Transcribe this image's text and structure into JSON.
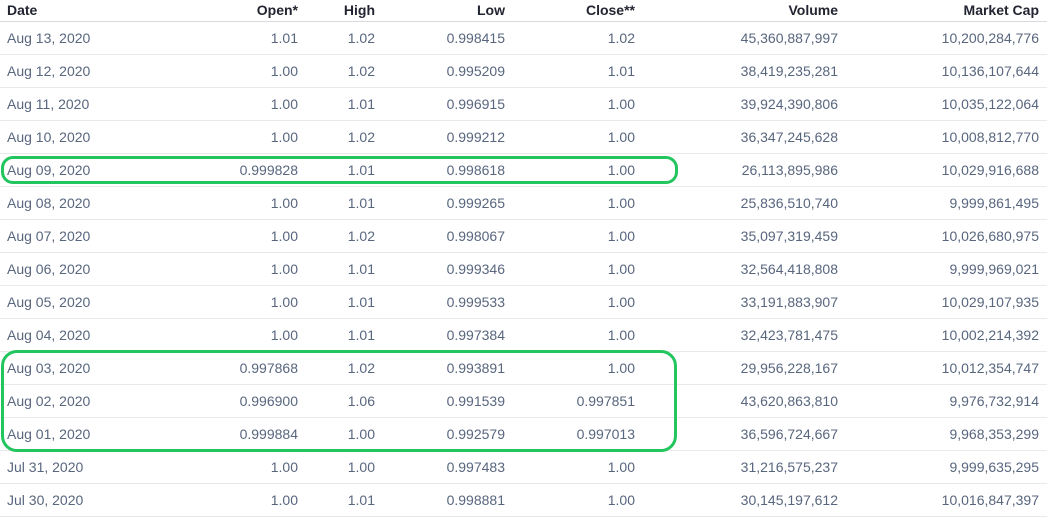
{
  "columns": {
    "date": "Date",
    "open": "Open*",
    "high": "High",
    "low": "Low",
    "close": "Close**",
    "volume": "Volume",
    "market_cap": "Market Cap"
  },
  "rows": [
    {
      "date": "Aug 13, 2020",
      "open": "1.01",
      "high": "1.02",
      "low": "0.998415",
      "close": "1.02",
      "volume": "45,360,887,997",
      "market_cap": "10,200,284,776"
    },
    {
      "date": "Aug 12, 2020",
      "open": "1.00",
      "high": "1.02",
      "low": "0.995209",
      "close": "1.01",
      "volume": "38,419,235,281",
      "market_cap": "10,136,107,644"
    },
    {
      "date": "Aug 11, 2020",
      "open": "1.00",
      "high": "1.01",
      "low": "0.996915",
      "close": "1.00",
      "volume": "39,924,390,806",
      "market_cap": "10,035,122,064"
    },
    {
      "date": "Aug 10, 2020",
      "open": "1.00",
      "high": "1.02",
      "low": "0.999212",
      "close": "1.00",
      "volume": "36,347,245,628",
      "market_cap": "10,008,812,770"
    },
    {
      "date": "Aug 09, 2020",
      "open": "0.999828",
      "high": "1.01",
      "low": "0.998618",
      "close": "1.00",
      "volume": "26,113,895,986",
      "market_cap": "10,029,916,688"
    },
    {
      "date": "Aug 08, 2020",
      "open": "1.00",
      "high": "1.01",
      "low": "0.999265",
      "close": "1.00",
      "volume": "25,836,510,740",
      "market_cap": "9,999,861,495"
    },
    {
      "date": "Aug 07, 2020",
      "open": "1.00",
      "high": "1.02",
      "low": "0.998067",
      "close": "1.00",
      "volume": "35,097,319,459",
      "market_cap": "10,026,680,975"
    },
    {
      "date": "Aug 06, 2020",
      "open": "1.00",
      "high": "1.01",
      "low": "0.999346",
      "close": "1.00",
      "volume": "32,564,418,808",
      "market_cap": "9,999,969,021"
    },
    {
      "date": "Aug 05, 2020",
      "open": "1.00",
      "high": "1.01",
      "low": "0.999533",
      "close": "1.00",
      "volume": "33,191,883,907",
      "market_cap": "10,029,107,935"
    },
    {
      "date": "Aug 04, 2020",
      "open": "1.00",
      "high": "1.01",
      "low": "0.997384",
      "close": "1.00",
      "volume": "32,423,781,475",
      "market_cap": "10,002,214,392"
    },
    {
      "date": "Aug 03, 2020",
      "open": "0.997868",
      "high": "1.02",
      "low": "0.993891",
      "close": "1.00",
      "volume": "29,956,228,167",
      "market_cap": "10,012,354,747"
    },
    {
      "date": "Aug 02, 2020",
      "open": "0.996900",
      "high": "1.06",
      "low": "0.991539",
      "close": "0.997851",
      "volume": "43,620,863,810",
      "market_cap": "9,976,732,914"
    },
    {
      "date": "Aug 01, 2020",
      "open": "0.999884",
      "high": "1.00",
      "low": "0.992579",
      "close": "0.997013",
      "volume": "36,596,724,667",
      "market_cap": "9,968,353,299"
    },
    {
      "date": "Jul 31, 2020",
      "open": "1.00",
      "high": "1.00",
      "low": "0.997483",
      "close": "1.00",
      "volume": "31,216,575,237",
      "market_cap": "9,999,635,295"
    },
    {
      "date": "Jul 30, 2020",
      "open": "1.00",
      "high": "1.01",
      "low": "0.998881",
      "close": "1.00",
      "volume": "30,145,197,612",
      "market_cap": "10,016,847,397"
    }
  ],
  "highlight_color": "#22c55e"
}
